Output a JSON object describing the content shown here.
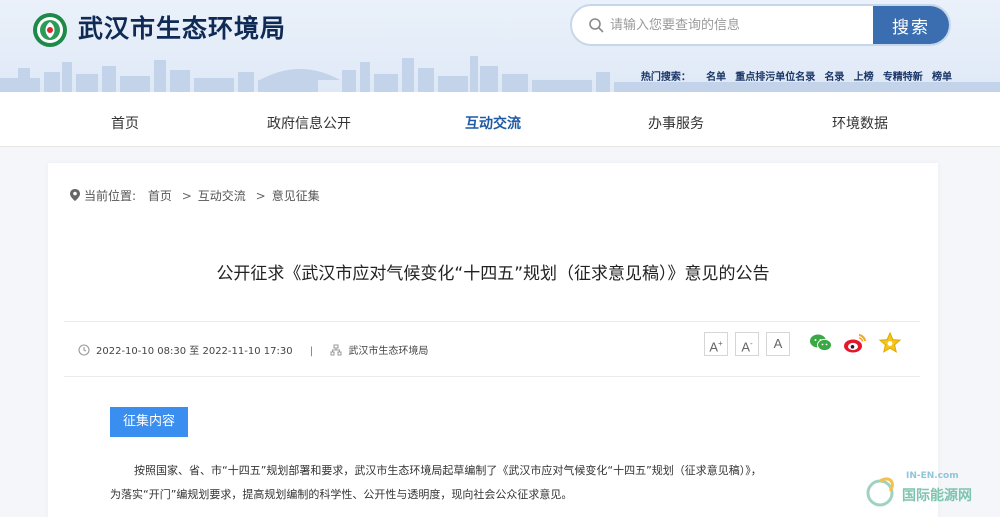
{
  "header": {
    "site_title": "武汉市生态环境局",
    "search": {
      "placeholder": "请输入您要查询的信息",
      "button_label": "搜索"
    },
    "hot_search": {
      "label": "热门搜索：",
      "items": [
        "名单",
        "重点排污单位名录",
        "名录",
        "上榜",
        "专精特新",
        "榜单"
      ]
    }
  },
  "nav": {
    "items": [
      {
        "label": "首页"
      },
      {
        "label": "政府信息公开"
      },
      {
        "label": "互动交流"
      },
      {
        "label": "办事服务"
      },
      {
        "label": "环境数据"
      }
    ],
    "active_label": "互动交流"
  },
  "breadcrumb": {
    "label": "当前位置:",
    "items": [
      "首页",
      "互动交流",
      "意见征集"
    ],
    "separator": ">"
  },
  "article": {
    "title": "公开征求《武汉市应对气候变化“十四五”规划（征求意见稿）》意见的公告",
    "time_range": "2022-10-10 08:30 至 2022-11-10 17:30",
    "divider": "|",
    "publisher": "武汉市生态环境局",
    "font_buttons": [
      "A",
      "A",
      "A"
    ],
    "section_tag": "征集内容",
    "paragraph_line1": "按照国家、省、市“十四五”规划部署和要求，武汉市生态环境局起草编制了《武汉市应对气候变化“十四五”规划（征求意见稿）》，",
    "paragraph_line2": "为落实“开门”编规划要求，提高规划编制的科学性、公开性与透明度，现向社会公众征求意见。"
  },
  "watermark": {
    "en": "IN-EN.com",
    "cn": "国际能源网"
  },
  "colors": {
    "brand_navy": "#0f2a55",
    "search_button": "#3b6eb0",
    "nav_active": "#1f5aa6",
    "tag_button": "#3a8ef0"
  },
  "icons": [
    "logo-emblem-icon",
    "search-icon",
    "location-pin-icon",
    "clock-icon",
    "org-icon",
    "wechat-icon",
    "weibo-icon",
    "favorite-star-icon"
  ]
}
